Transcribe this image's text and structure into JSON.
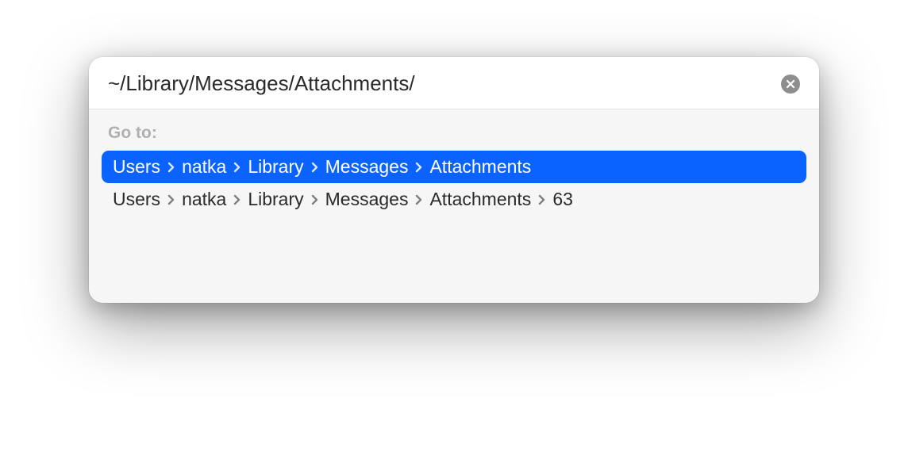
{
  "input": {
    "value": "~/Library/Messages/Attachments/"
  },
  "goto_label": "Go to:",
  "results": [
    {
      "selected": true,
      "segments": [
        "Users",
        "natka",
        "Library",
        "Messages",
        "Attachments"
      ]
    },
    {
      "selected": false,
      "segments": [
        "Users",
        "natka",
        "Library",
        "Messages",
        "Attachments",
        "63"
      ]
    }
  ]
}
